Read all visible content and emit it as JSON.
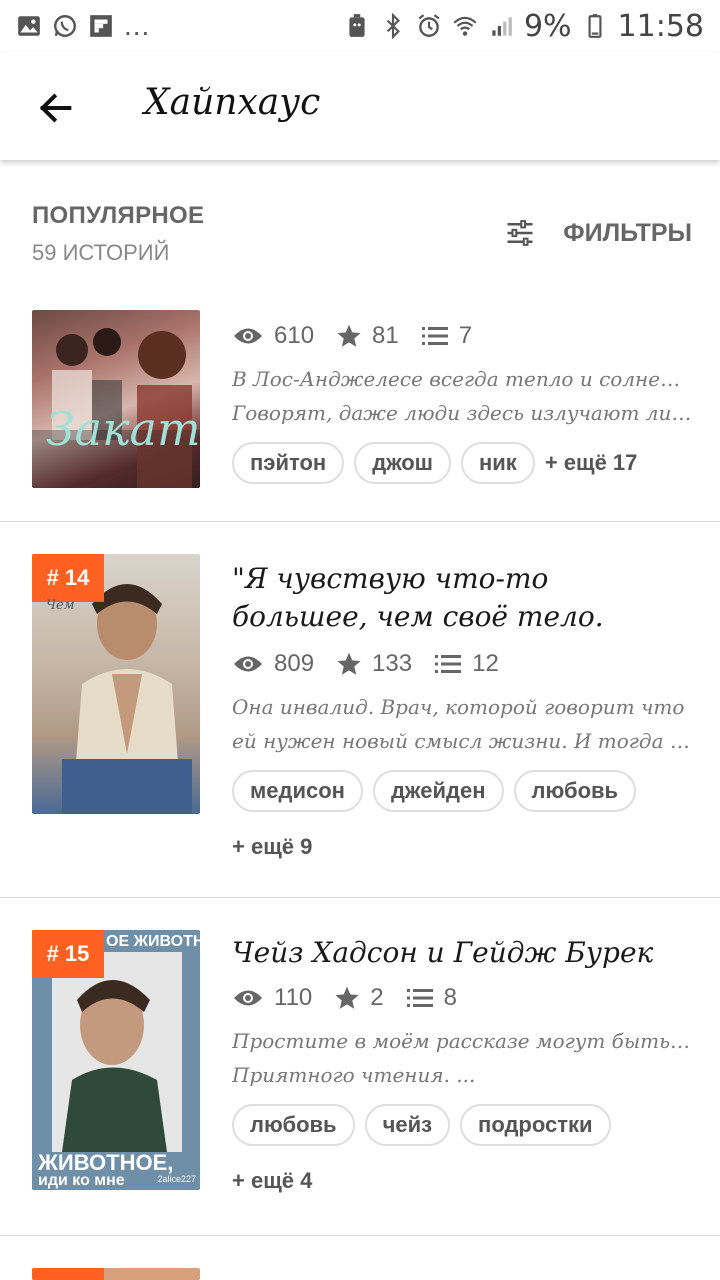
{
  "status_bar": {
    "left_icons": [
      "gallery-icon",
      "whatsapp-icon",
      "flipboard-icon"
    ],
    "dots": "...",
    "right_icons": [
      "android-icon",
      "bluetooth-icon",
      "alarm-icon",
      "wifi-icon",
      "signal-icon"
    ],
    "battery_percent": "9%",
    "time": "11:58"
  },
  "appbar": {
    "back_icon": "arrow-left-icon",
    "title": "Хайпхаус"
  },
  "section": {
    "title": "ПОПУЛЯРНОЕ",
    "count": "59 ИСТОРИЙ",
    "filters_label": "ФИЛЬТРЫ",
    "filters_icon": "sliders-icon"
  },
  "stories": [
    {
      "rank": "",
      "title": "",
      "views": "610",
      "votes": "81",
      "parts": "7",
      "desc_lines": [
        "В Лос-Анджелесе всегда тепло и солнечно.",
        "Говорят, даже люди здесь излучают лишь д..."
      ],
      "tags": [
        "пэйтон",
        "джош",
        "ник"
      ],
      "more": "+ ещё 17",
      "cover_text": "Закат"
    },
    {
      "rank": "# 14",
      "title": "\"Я чувствую что-то большее, чем своё тело.",
      "views": "809",
      "votes": "133",
      "parts": "12",
      "desc_lines": [
        "Она инвалид. Врач, которой говорит что",
        "ей нужен новый смысл жизни. И тогда она в..."
      ],
      "tags": [
        "медисон",
        "джейден",
        "любовь"
      ],
      "more": "+ ещё 9",
      "cover_text": "Чем"
    },
    {
      "rank": "# 15",
      "title": "Чейз Хадсон и Гейдж Бурек",
      "views": "110",
      "votes": "2",
      "parts": "8",
      "desc_lines": [
        "Простите в моём рассказе могут быть ошибки.",
        "Приятного чтения. ..."
      ],
      "tags": [
        "любовь",
        "чейз",
        "подростки"
      ],
      "more": "+ ещё 4",
      "cover_text": "ЖИВОТНОЕ,",
      "cover_text_2": "иди ко мне",
      "cover_text_top": "ОЕ ЖИВОТНОЕ",
      "cover_author": "2alice227"
    }
  ],
  "colors": {
    "accent": "#ff6122",
    "text": "#222222",
    "muted": "#777777"
  }
}
